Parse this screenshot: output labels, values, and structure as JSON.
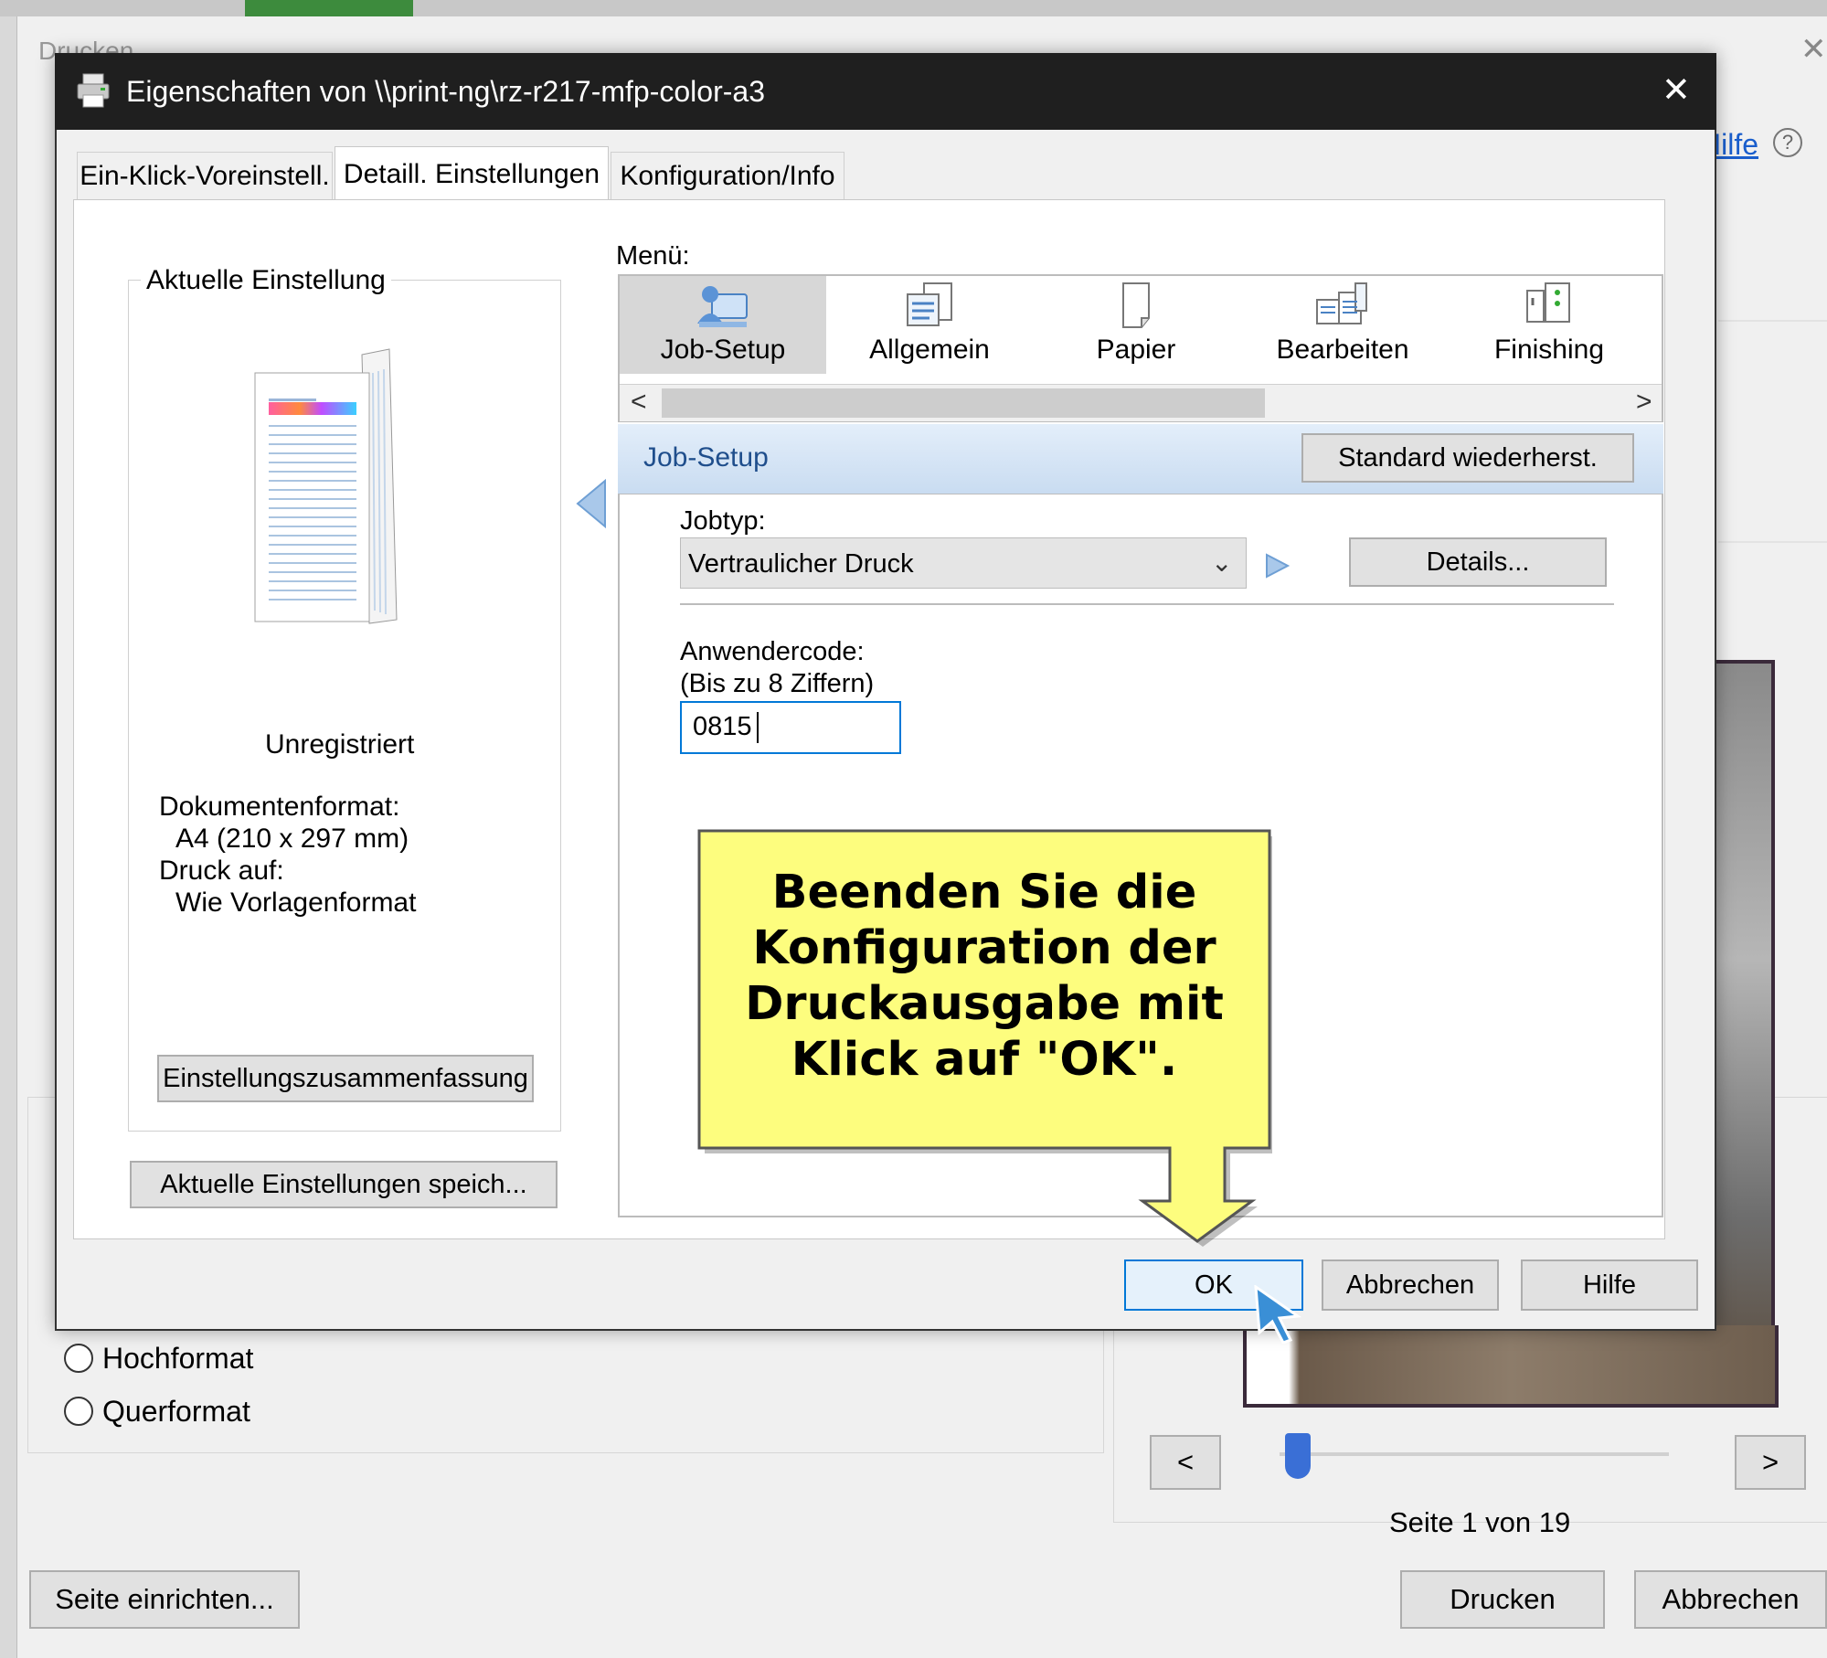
{
  "bg_dialog": {
    "title": "Drucken",
    "help_link": "Hilfe",
    "orientation": {
      "portrait": "Hochformat",
      "landscape": "Querformat"
    },
    "page_setup_button": "Seite einrichten...",
    "print_button": "Drucken",
    "cancel_button": "Abbrechen",
    "preview_nav": {
      "prev": "<",
      "next": ">",
      "page_indicator": "Seite 1 von 19",
      "slider_fraction": 0.0
    }
  },
  "dialog": {
    "title": "Eigenschaften von \\\\print-ng\\rz-r217-mfp-color-a3",
    "close_glyph": "✕",
    "tabs": [
      "Ein-Klick-Voreinstell.",
      "Detaill. Einstellungen",
      "Konfiguration/Info"
    ],
    "active_tab": 1,
    "current_settings": {
      "heading": "Aktuelle Einstellung",
      "status": "Unregistriert",
      "doc_format_label": "Dokumentenformat:",
      "doc_format_value": "A4 (210 x 297 mm)",
      "print_on_label": "Druck auf:",
      "print_on_value": "Wie Vorlagenformat",
      "summary_button": "Einstellungszusammenfassung",
      "save_button": "Aktuelle Einstellungen speich..."
    },
    "menu": {
      "label": "Menü:",
      "items": [
        {
          "label": "Job-Setup",
          "icon": "job-setup-icon",
          "selected": true
        },
        {
          "label": "Allgemein",
          "icon": "general-icon",
          "selected": false
        },
        {
          "label": "Papier",
          "icon": "paper-icon",
          "selected": false
        },
        {
          "label": "Bearbeiten",
          "icon": "edit-layout-icon",
          "selected": false
        },
        {
          "label": "Finishing",
          "icon": "finishing-icon",
          "selected": false
        }
      ],
      "scroll_left": "<",
      "scroll_right": ">"
    },
    "section": {
      "title": "Job-Setup",
      "restore_button": "Standard wiederherst."
    },
    "job_type": {
      "label": "Jobtyp:",
      "value": "Vertraulicher Druck",
      "details_button": "Details..."
    },
    "user_code": {
      "label": "Anwendercode:",
      "hint": "(Bis zu 8 Ziffern)",
      "value": "0815"
    },
    "callout": {
      "lines": [
        "Beenden Sie die",
        "Konfiguration der",
        "Druckausgabe mit",
        "Klick auf \"OK\"."
      ]
    },
    "buttons": {
      "ok": "OK",
      "cancel": "Abbrechen",
      "help": "Hilfe"
    }
  },
  "colors": {
    "titlebar": "#1f1f1f",
    "section_header": "#d3e3f3",
    "section_text": "#1f4e8c",
    "callout_fill": "#fdfd7e",
    "ok_border": "#0078d7",
    "cursor": "#3a8fd6"
  }
}
